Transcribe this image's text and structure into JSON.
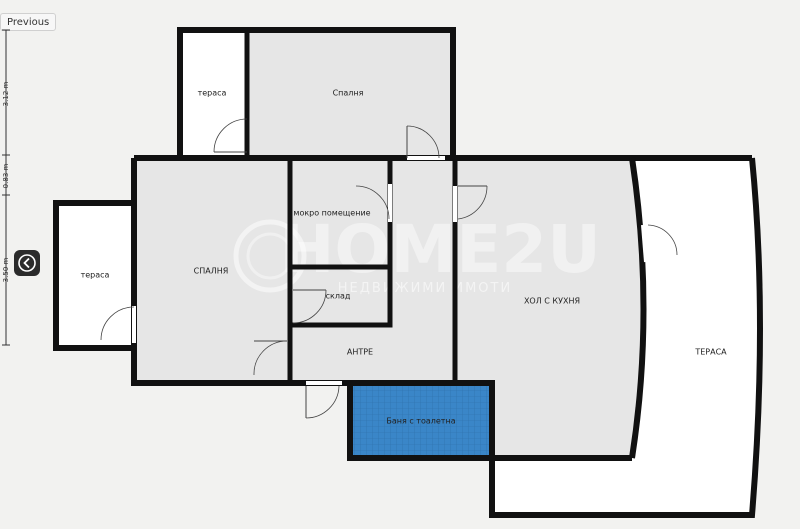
{
  "nav": {
    "previous_label": "Previous"
  },
  "dimensions": [
    "3.12 m",
    "0.83 m",
    "3.50 m"
  ],
  "watermark": {
    "brand": "HOME2U",
    "tagline": "НЕДВИЖИМИ ИМОТИ"
  },
  "rooms": {
    "terrace_top": "тераса",
    "bedroom_top": "Спалня",
    "terrace_left": "тераса",
    "bedroom_left": "СПАЛНЯ",
    "wet_room": "мокро помещение",
    "storage": "склад",
    "hall": "АНТРЕ",
    "bathroom": "Баня с тоалетна",
    "living_kitchen": "ХОЛ С КУХНЯ",
    "terrace_big": "ТЕРАСА"
  },
  "colors": {
    "wall": "#111111",
    "floor": "#e6e6e6",
    "bathroom": "#3a86c8",
    "terrace": "#ffffff"
  }
}
